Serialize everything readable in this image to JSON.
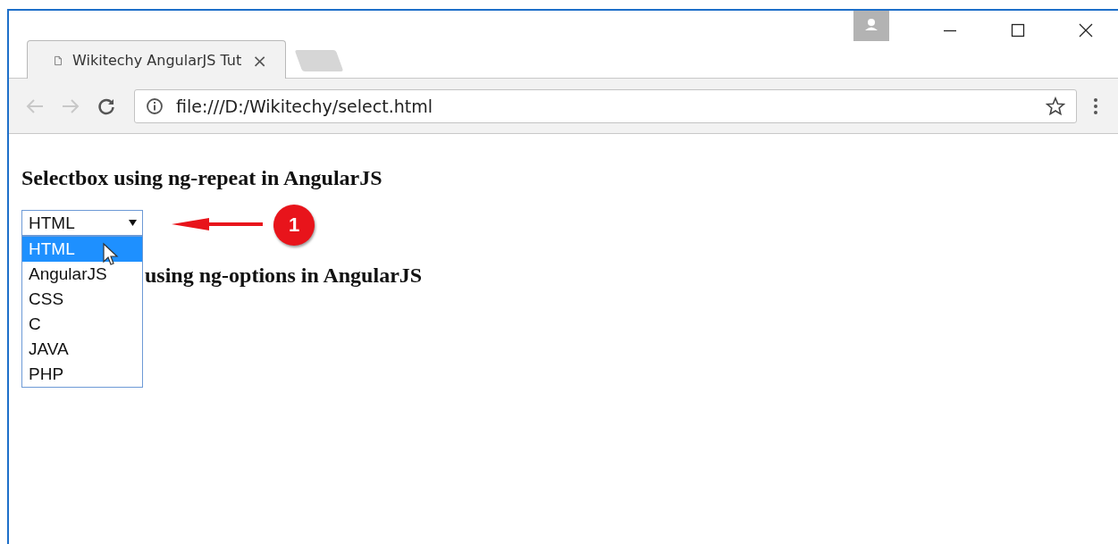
{
  "tabs": [
    {
      "title": "Wikitechy AngularJS Tut",
      "selected": true,
      "close": "×"
    }
  ],
  "address_bar": {
    "url": "file:///D:/Wikitechy/select.html"
  },
  "page": {
    "heading": "Selectbox using ng-repeat in AngularJS",
    "select": {
      "value": "HTML",
      "expanded": true,
      "options": [
        {
          "label": "HTML",
          "selected": true
        },
        {
          "label": "AngularJS",
          "selected": false
        },
        {
          "label": "CSS",
          "selected": false
        },
        {
          "label": "C",
          "selected": false
        },
        {
          "label": "JAVA",
          "selected": false
        },
        {
          "label": "PHP",
          "selected": false
        }
      ]
    },
    "heading_2": "using ng-options in AngularJS"
  },
  "annotation": {
    "badge": "1"
  }
}
